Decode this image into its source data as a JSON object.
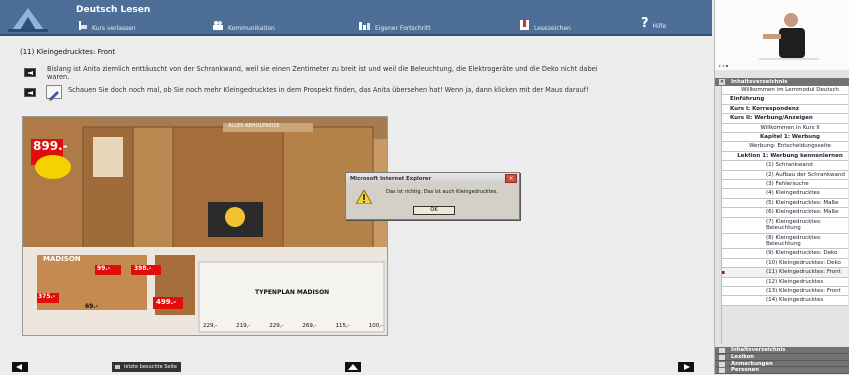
{
  "header": {
    "title": "Deutsch Lesen",
    "nav": [
      {
        "label": "Kurs verlassen",
        "icon": "exit-icon"
      },
      {
        "label": "Kommunikation",
        "icon": "people-icon"
      },
      {
        "label": "Eigener Fortschritt",
        "icon": "progress-chart-icon"
      },
      {
        "label": "Lesezeichen",
        "icon": "bookmark-icon"
      },
      {
        "label": "Hilfe",
        "icon": "help-icon"
      }
    ]
  },
  "main": {
    "page_title": "(11) Kleingedrucktes: Front",
    "para1": "Bislang ist Anita ziemlich enttäuscht von der Schrankwand, weil sie einen Zentimeter zu breit ist und weil die Beleuchtung, die Elektrogeräte und die Deko nicht dabei waren.",
    "para2": "Schauen Sie doch noch mal, ob Sie noch mehr Kleingedrucktes in dem Prospekt finden, das Anita übersehen hat! Wenn ja, dann klicken mit der Maus darauf!",
    "brochure": {
      "price_main": "899.-",
      "banner": "ALLES ABHOLPREISE",
      "brand": "MADISON",
      "price_a": "99.-",
      "price_b": "398.-",
      "price_c": "375.-",
      "price_d": "69.-",
      "price_e": "499.-",
      "program_title": "TYPENPLAN MADISON",
      "prices_row": [
        "229,-",
        "219,-",
        "229,-",
        "269,-",
        "115,-",
        "100,-"
      ]
    }
  },
  "dialog": {
    "title": "Microsoft Internet Explorer",
    "message": "Das ist richtig. Das ist auch Kleingedrucktes.",
    "ok": "OK"
  },
  "footer": {
    "last_page": "letzte besuchte Seite"
  },
  "right": {
    "toc_header": "Inhaltsverzeichnis",
    "toc": [
      {
        "label": "Willkommen im Lernmodul Deutsch",
        "style": "center"
      },
      {
        "label": "Einführung",
        "style": "bold"
      },
      {
        "label": "Kurs I: Korrespondenz",
        "style": "bold"
      },
      {
        "label": "Kurs II: Werbung/Anzeigen",
        "style": "bold"
      },
      {
        "label": "Willkommen in Kurs II",
        "style": "center"
      },
      {
        "label": "Kapitel 1: Werbung",
        "style": "bold-center"
      },
      {
        "label": "Werbung: Entscheidungsseite",
        "style": "center"
      },
      {
        "label": "Lektion 1: Werbung kennenlernen",
        "style": "bold-center"
      },
      {
        "label": "(1) Schrankwand",
        "style": "sub"
      },
      {
        "label": "(2) Aufbau der Schrankwand",
        "style": "sub"
      },
      {
        "label": "(3) Fehlersuche",
        "style": "sub"
      },
      {
        "label": "(4) Kleingedrucktes",
        "style": "sub"
      },
      {
        "label": "(5) Kleingedrucktes: Maße",
        "style": "sub"
      },
      {
        "label": "(6) Kleingedrucktes: Maße",
        "style": "sub"
      },
      {
        "label": "(7) Kleingedrucktes: Beleuchtung",
        "style": "sub"
      },
      {
        "label": "(8) Kleingedrucktes: Beleuchtung",
        "style": "sub"
      },
      {
        "label": "(9) Kleingedrucktes: Deko",
        "style": "sub"
      },
      {
        "label": "(10) Kleingedrucktes: Deko",
        "style": "sub"
      },
      {
        "label": "(11) Kleingedrucktes: Front",
        "style": "sub",
        "current": true
      },
      {
        "label": "(12) Kleingedrucktes",
        "style": "sub"
      },
      {
        "label": "(13) Kleingedrucktes: Front",
        "style": "sub"
      },
      {
        "label": "(14) Kleingedrucktes",
        "style": "sub"
      }
    ],
    "bottom_panels": [
      "Inhaltsverzeichnis",
      "Lexikon",
      "Anmerkungen",
      "Personen"
    ]
  },
  "colors": {
    "header": "#4d6f97",
    "panel": "#737373"
  }
}
